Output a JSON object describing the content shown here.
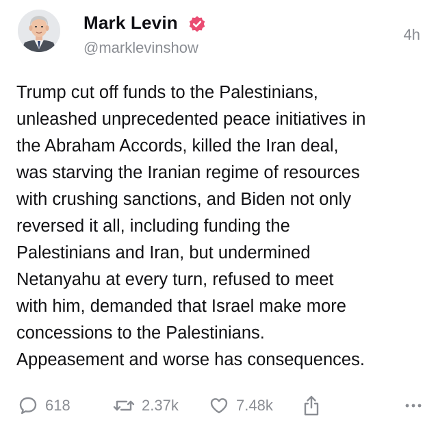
{
  "author": {
    "name": "Mark Levin",
    "handle": "@marklevinshow",
    "verified": true
  },
  "timestamp": "4h",
  "text_lines": [
    "Trump cut off funds to the Palestinians,",
    "unleashed unprecedented peace initiatives in",
    "the Abraham Accords, killed the Iran deal,",
    "was starving the Iranian regime of resources",
    "with crushing sanctions, and Biden not only",
    "reversed it all, including funding the",
    "Palestinians and Iran, but undermined",
    "Netanyahu at every turn, refused to meet",
    "with him, demanded that Israel make more",
    "concessions to the Palestinians.",
    "Appeasement and worse has consequences."
  ],
  "actions": {
    "replies": "618",
    "reposts": "2.37k",
    "likes": "7.48k"
  },
  "icons": {
    "verified": "verified-badge-icon",
    "reply": "comment-bubble-icon",
    "repost": "repost-arrows-icon",
    "like": "heart-icon",
    "share": "share-upload-icon",
    "more": "more-dots-icon"
  },
  "colors": {
    "verified_badge": "#ea4c72",
    "text": "#111114",
    "muted": "#8a8d93"
  }
}
